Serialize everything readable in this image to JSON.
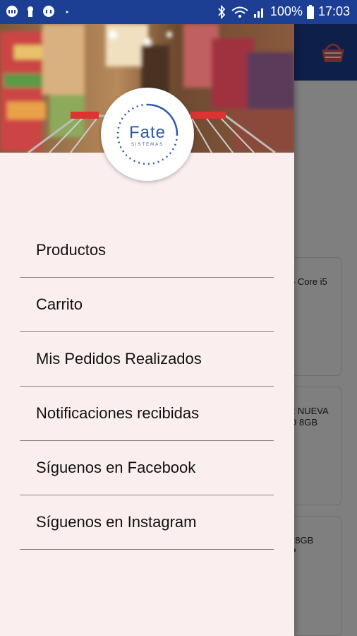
{
  "status_bar": {
    "battery": "100%",
    "time": "17:03"
  },
  "background": {
    "cards": [
      {
        "text": "5 Core i5"
      },
      {
        "text": "2 NUEVA\nD 8GB"
      },
      {
        "text": "28GB\nP"
      }
    ]
  },
  "drawer": {
    "logo": {
      "name": "Fate",
      "subtitle": "SISTEMAS"
    },
    "menu": [
      {
        "label": "Productos"
      },
      {
        "label": "Carrito"
      },
      {
        "label": "Mis Pedidos Realizados"
      },
      {
        "label": "Notificaciones recibidas"
      },
      {
        "label": "Síguenos en Facebook"
      },
      {
        "label": "Síguenos en Instagram"
      }
    ]
  },
  "colors": {
    "primary": "#1c3f93",
    "drawer_bg": "#fbeeee",
    "logo_blue": "#2d5aa8"
  }
}
